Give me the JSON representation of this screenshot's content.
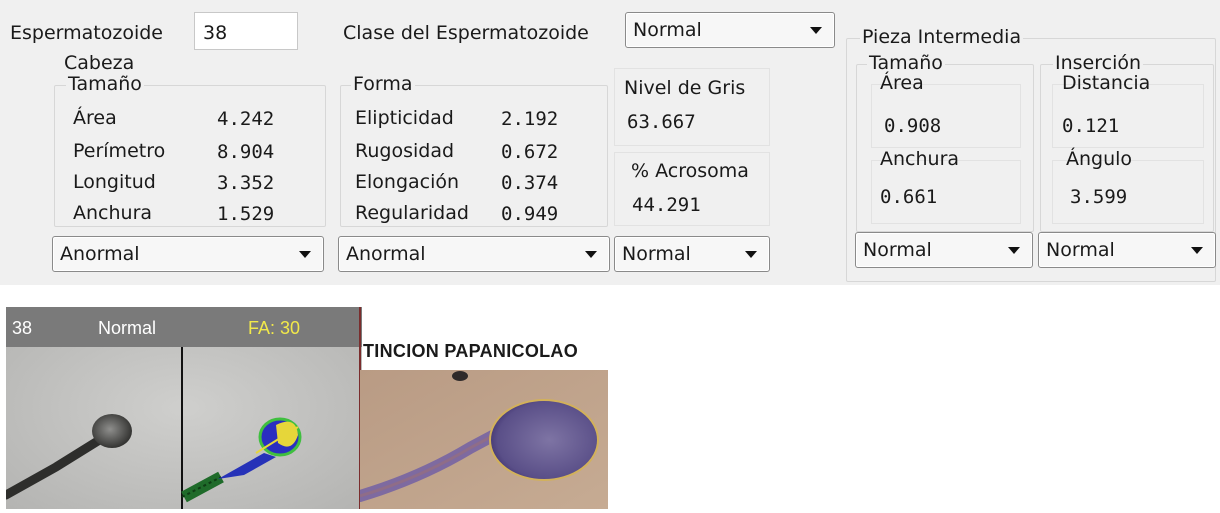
{
  "header": {
    "sperm_label": "Espermatozoide",
    "sperm_value": "38",
    "class_label": "Clase del Espermatozoide",
    "class_value": "Normal"
  },
  "cabeza": {
    "title": "Cabeza",
    "tamano": {
      "title": "Tamaño",
      "rows": [
        {
          "label": "Área",
          "value": "4.242"
        },
        {
          "label": "Perímetro",
          "value": "8.904"
        },
        {
          "label": "Longitud",
          "value": "3.352"
        },
        {
          "label": "Anchura",
          "value": "1.529"
        }
      ],
      "combo": "Anormal"
    },
    "forma": {
      "title": "Forma",
      "rows": [
        {
          "label": "Elipticidad",
          "value": "2.192"
        },
        {
          "label": "Rugosidad",
          "value": "0.672"
        },
        {
          "label": "Elongación",
          "value": "0.374"
        },
        {
          "label": "Regularidad",
          "value": "0.949"
        }
      ],
      "combo": "Anormal"
    },
    "nivel_gris": {
      "title": "Nivel de Gris",
      "value": "63.667"
    },
    "acrosoma": {
      "title": "% Acrosoma",
      "value": "44.291"
    },
    "combo_right": "Normal"
  },
  "pieza": {
    "title": "Pieza Intermedia",
    "tamano": {
      "title": "Tamaño",
      "area_label": "Área",
      "area_value": "0.908",
      "anchura_label": "Anchura",
      "anchura_value": "0.661",
      "combo": "Normal"
    },
    "insercion": {
      "title": "Inserción",
      "distancia_label": "Distancia",
      "distancia_value": "0.121",
      "angulo_label": "Ángulo",
      "angulo_value": "3.599",
      "combo": "Normal"
    }
  },
  "image_panel": {
    "id": "38",
    "class": "Normal",
    "fa": "FA: 30",
    "fa_color": "#f2e94a",
    "stain_title": "TINCION PAPANICOLAO"
  },
  "icons": {
    "combo_arrow": "chevron-down-icon"
  }
}
